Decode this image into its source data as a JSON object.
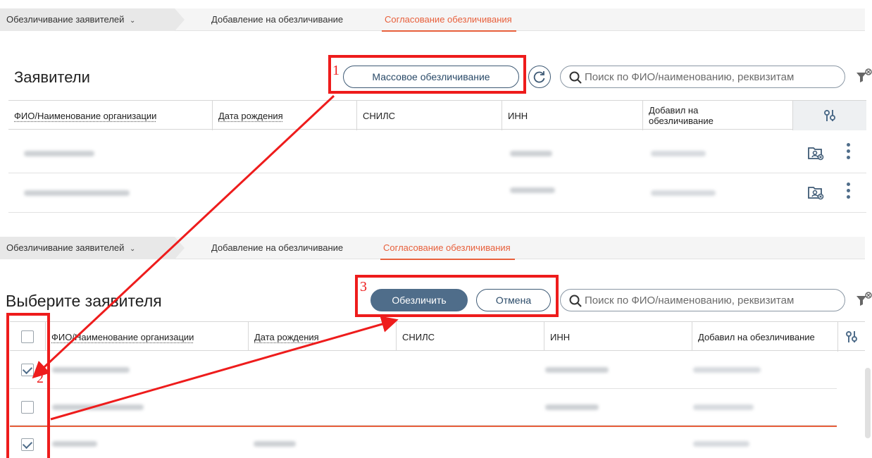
{
  "tabs": {
    "first": "Обезличивание заявителей",
    "second": "Добавление на обезличивание",
    "active": "Согласование обезличивания"
  },
  "top": {
    "heading": "Заявители",
    "mass_button": "Массовое обезличивание",
    "search_placeholder": "Поиск по ФИО/наименованию, реквизитам",
    "columns": {
      "name": "ФИО/Наименование организации",
      "birth": "Дата рождения",
      "snils": "СНИЛС",
      "inn": "ИНН",
      "added_line1": "Добавил на",
      "added_line2": "обезличивание"
    }
  },
  "bottom": {
    "heading": "Выберите заявителя",
    "primary_button": "Обезличить",
    "cancel_button": "Отмена",
    "search_placeholder": "Поиск по ФИО/наименованию, реквизитам",
    "columns": {
      "name": "ФИО/Наименование организации",
      "birth": "Дата рождения",
      "snils": "СНИЛС",
      "inn": "ИНН",
      "added": "Добавил на обезличивание"
    },
    "rows": [
      {
        "checked": true
      },
      {
        "checked": false
      },
      {
        "checked": true
      }
    ]
  },
  "annotations": [
    "1",
    "2",
    "3"
  ],
  "colors": {
    "accent": "#e8603c",
    "primary": "#4f6d8a",
    "annotation": "#ee1c1c"
  },
  "icons": [
    "chevron-down-icon",
    "refresh-icon",
    "search-icon",
    "filter-clear-icon",
    "column-settings-icon",
    "folder-user-icon",
    "kebab-menu-icon",
    "checkbox-icon"
  ]
}
